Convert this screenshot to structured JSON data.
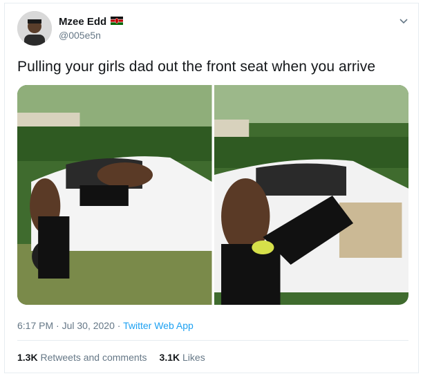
{
  "author": {
    "name": "Mzee Edd",
    "handle": "@005e5n",
    "flag_icon": "kenya-flag-icon"
  },
  "tweet": {
    "text": "Pulling your girls dad out the front seat when you arrive"
  },
  "media": {
    "photos": [
      "photo-left",
      "photo-right"
    ]
  },
  "meta": {
    "time": "6:17 PM",
    "separator1": " · ",
    "date": "Jul 30, 2020",
    "separator2": " · ",
    "source": "Twitter Web App"
  },
  "stats": {
    "retweets_count": "1.3K",
    "retweets_label": "Retweets and comments",
    "likes_count": "3.1K",
    "likes_label": "Likes"
  },
  "colors": {
    "accent": "#1da1f2",
    "secondary_text": "#657786",
    "border": "#e6ecf0"
  }
}
